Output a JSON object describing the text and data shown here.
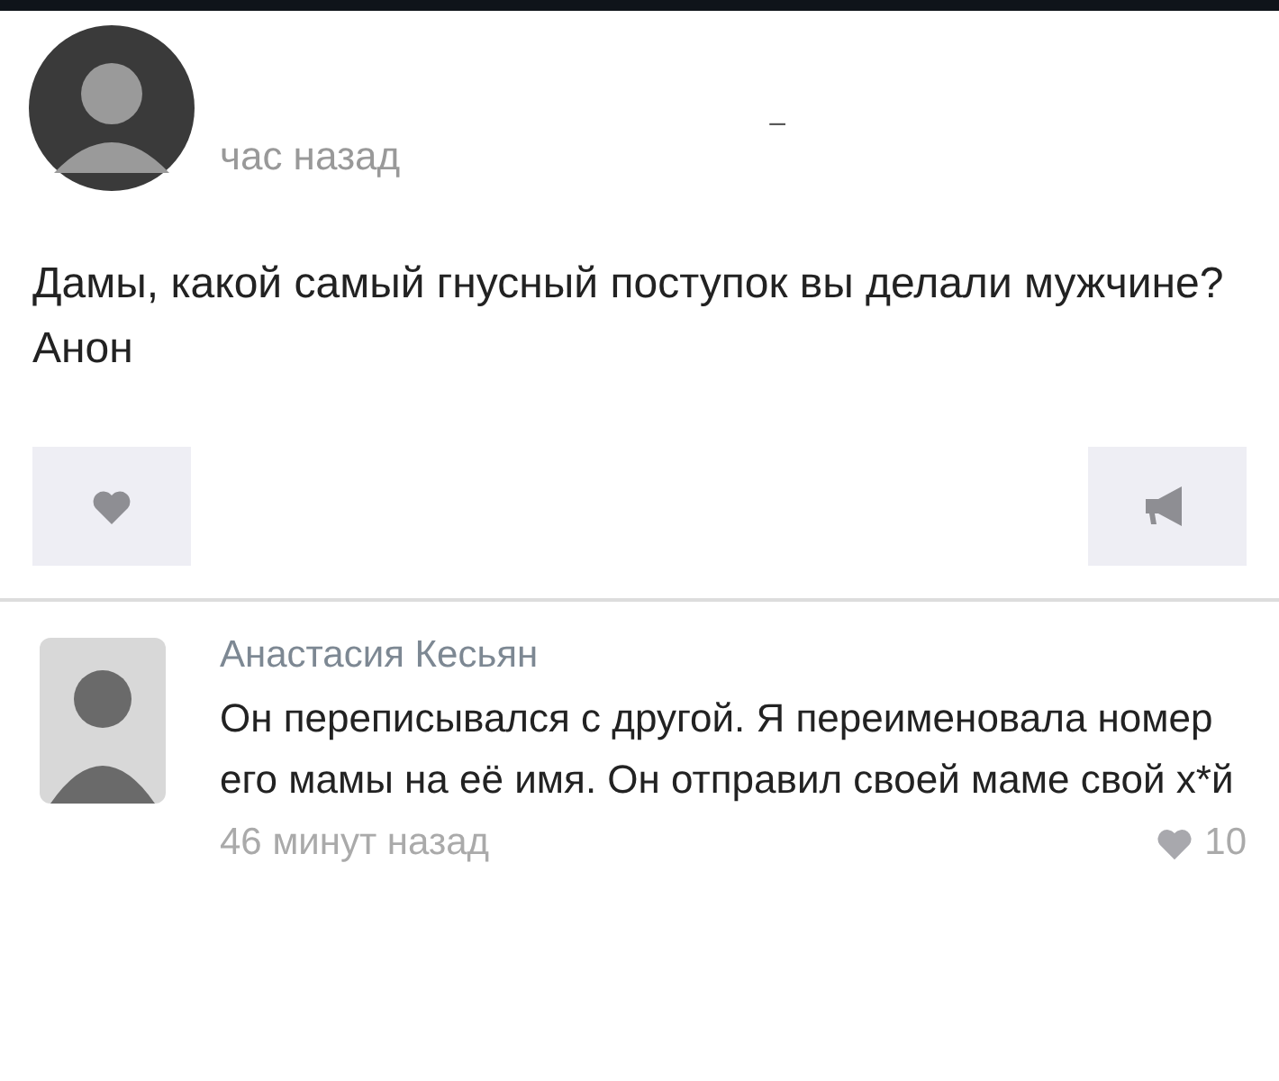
{
  "post": {
    "time": "час назад",
    "mark": "–",
    "text": "Дамы, какой самый гнусный поступок вы делали мужчине?\nАнон"
  },
  "comment": {
    "author": "Анастасия Кесьян",
    "text": "Он переписывался с другой. Я переименовала номер его мамы на её имя. Он отправил своей маме свой х*й",
    "time": "46 минут назад",
    "likes": "10"
  }
}
